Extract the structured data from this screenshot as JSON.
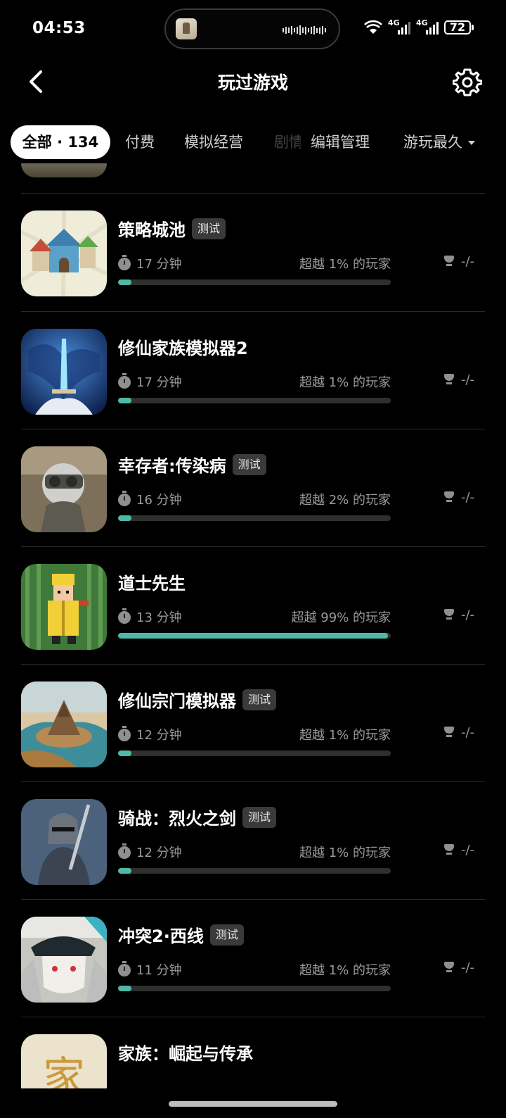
{
  "status_bar": {
    "time": "04:53",
    "net1": "4G",
    "net2": "4G",
    "battery": "72"
  },
  "header": {
    "title": "玩过游戏",
    "back_icon": "chevron-left-icon",
    "settings_icon": "gear-icon"
  },
  "tabs": [
    {
      "label": "全部 · 134",
      "active": true
    },
    {
      "label": "付费"
    },
    {
      "label": "模拟经营"
    },
    {
      "label": "剧情"
    },
    {
      "label": "编辑管理"
    },
    {
      "label": "游玩最久"
    }
  ],
  "games": [
    {
      "name": "策略城池",
      "badge": "测试",
      "playtime": "17 分钟",
      "beat": "超越 1% 的玩家",
      "progress": 0.05,
      "achievement": "-/-"
    },
    {
      "name": "修仙家族模拟器2",
      "badge": "",
      "playtime": "17 分钟",
      "beat": "超越 1% 的玩家",
      "progress": 0.05,
      "achievement": "-/-"
    },
    {
      "name": "幸存者:传染病",
      "badge": "测试",
      "playtime": "16 分钟",
      "beat": "超越 2% 的玩家",
      "progress": 0.05,
      "achievement": "-/-"
    },
    {
      "name": "道士先生",
      "badge": "",
      "playtime": "13 分钟",
      "beat": "超越 99% 的玩家",
      "progress": 0.99,
      "achievement": "-/-"
    },
    {
      "name": "修仙宗门模拟器",
      "badge": "测试",
      "playtime": "12 分钟",
      "beat": "超越 1% 的玩家",
      "progress": 0.05,
      "achievement": "-/-"
    },
    {
      "name": "骑战：烈火之剑",
      "badge": "测试",
      "playtime": "12 分钟",
      "beat": "超越 1% 的玩家",
      "progress": 0.05,
      "achievement": "-/-"
    },
    {
      "name": "冲突2·西线",
      "badge": "测试",
      "playtime": "11 分钟",
      "beat": "超越 1% 的玩家",
      "progress": 0.05,
      "achievement": "-/-"
    },
    {
      "name": "家族：崛起与传承",
      "badge": "",
      "playtime": "",
      "beat": "",
      "progress": 0,
      "achievement": ""
    }
  ],
  "colors": {
    "accent": "#4fb9a8",
    "background": "#000000",
    "track": "#2f2f2f"
  }
}
